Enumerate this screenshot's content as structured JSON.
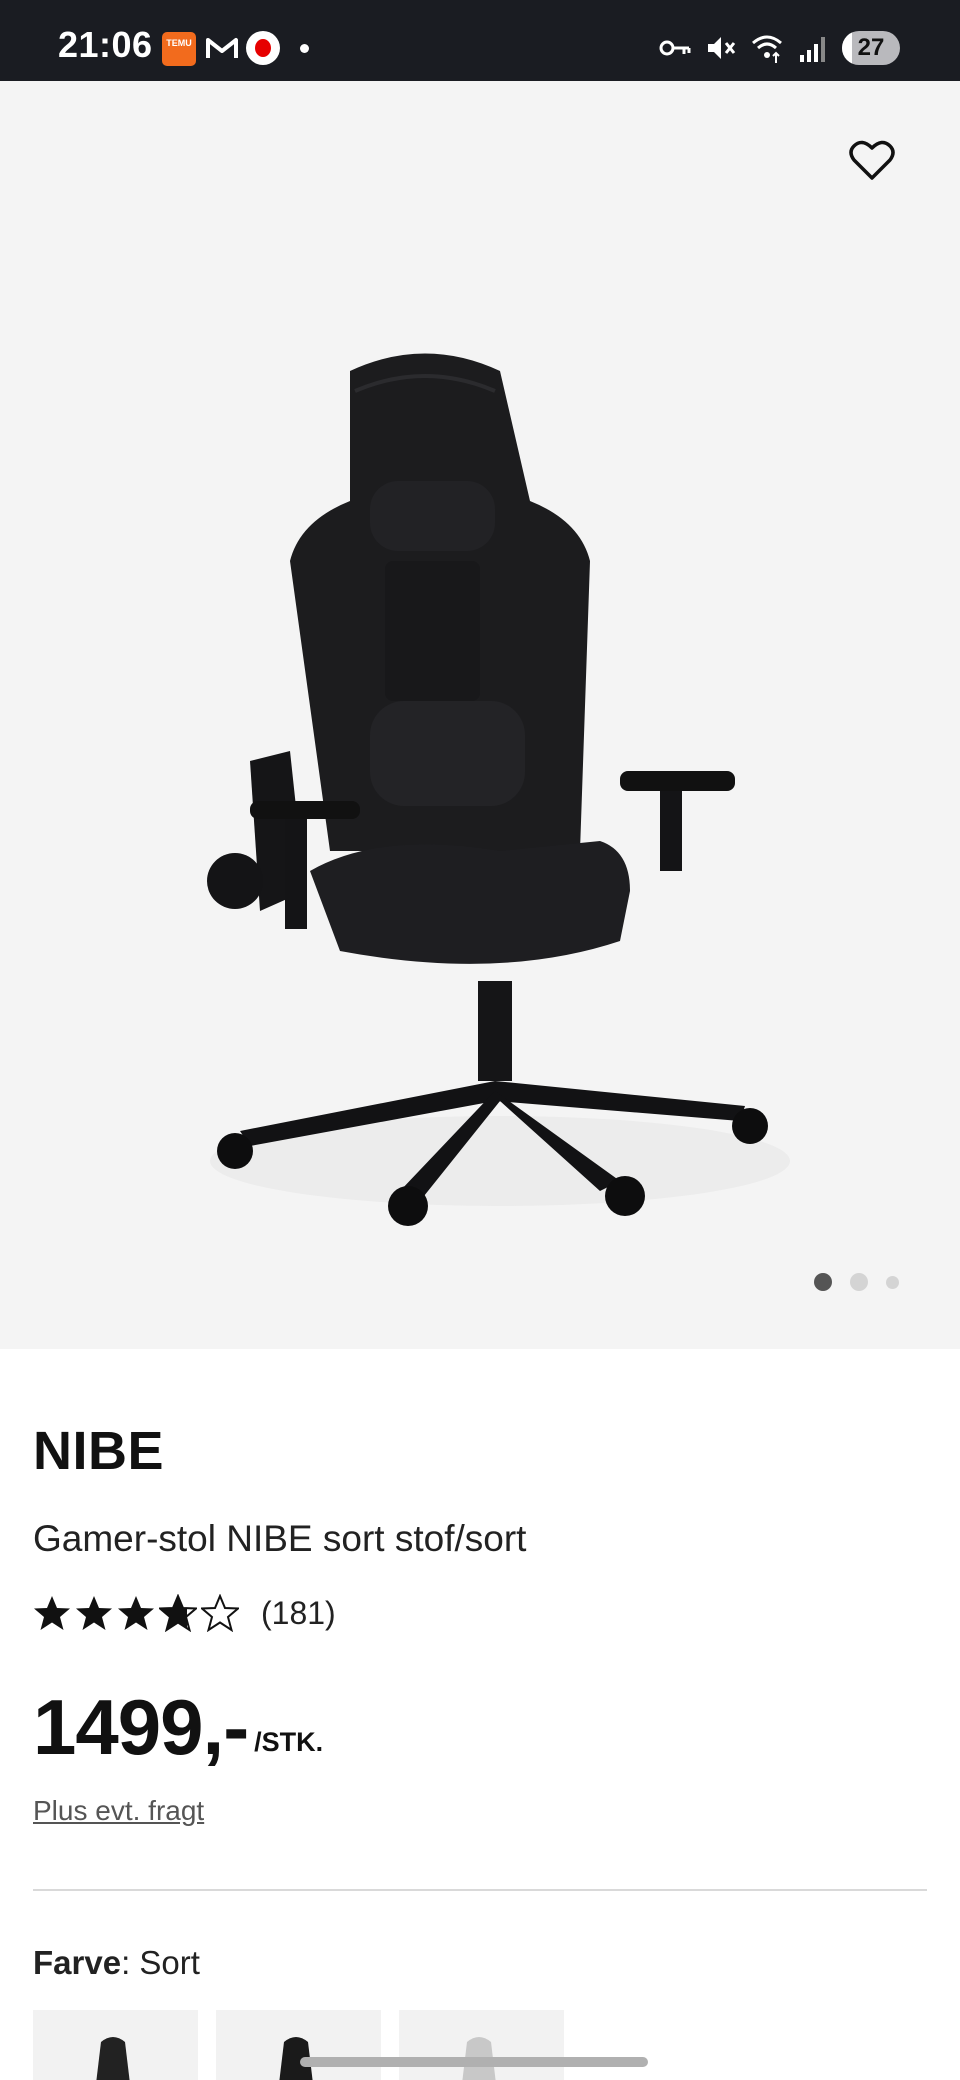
{
  "status_bar": {
    "time": "21:06",
    "battery": "27",
    "temu_label": "TEMU",
    "icons": [
      "temu-icon",
      "gmail-icon",
      "vodafone-icon",
      "notification-dot-icon",
      "vpn-key-icon",
      "mute-icon",
      "wifi-icon",
      "signal-icon",
      "battery-icon"
    ]
  },
  "product": {
    "brand": "NIBE",
    "title": "Gamer-stol NIBE sort stof/sort",
    "rating": 3.75,
    "rating_count": "(181)",
    "price": "1499,-",
    "price_unit": "/STK.",
    "shipping_link": "Plus evt. fragt",
    "color_label": "Farve",
    "color_value": ": Sort"
  },
  "carousel": {
    "total_slides": 3,
    "active_slide": 1
  },
  "colors": {
    "status_bg": "#1a1c22",
    "hero_bg": "#f4f4f4",
    "text": "#111111",
    "link": "#555555"
  }
}
